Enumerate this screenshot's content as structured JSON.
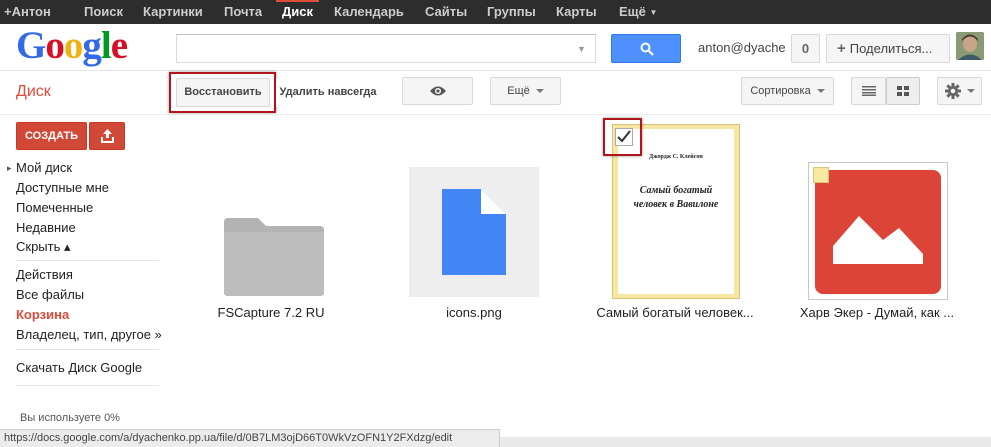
{
  "gbar": {
    "items": [
      {
        "label": "+Антон"
      },
      {
        "label": "Поиск"
      },
      {
        "label": "Картинки"
      },
      {
        "label": "Почта"
      },
      {
        "label": "Диск",
        "active": true
      },
      {
        "label": "Календарь"
      },
      {
        "label": "Сайты"
      },
      {
        "label": "Группы"
      },
      {
        "label": "Карты"
      },
      {
        "label": "Ещё"
      }
    ]
  },
  "header": {
    "logo": [
      "G",
      "o",
      "o",
      "g",
      "l",
      "e"
    ],
    "search_value": "",
    "user_email": "anton@dyachenko.pp.ua",
    "notification_count": "0",
    "share_label": "Поделиться..."
  },
  "toolbar": {
    "title": "Диск",
    "restore_label": "Восстановить",
    "delete_forever_label": "Удалить навсегда",
    "more_label": "Ещё",
    "sort_label": "Сортировка"
  },
  "sidebar": {
    "create_label": "СОЗДАТЬ",
    "items": [
      {
        "label": "Мой диск"
      },
      {
        "label": "Доступные мне"
      },
      {
        "label": "Помеченные"
      },
      {
        "label": "Недавние"
      },
      {
        "label": "Скрыть ▴"
      },
      {
        "label": "Действия"
      },
      {
        "label": "Все файлы"
      },
      {
        "label": "Корзина",
        "active": true
      },
      {
        "label": "Владелец, тип, другое »"
      },
      {
        "label": "Скачать Диск Google"
      }
    ],
    "usage_text": "Вы используете 0%"
  },
  "files": [
    {
      "name": "FSCapture 7.2 RU",
      "icon": "folder-icon"
    },
    {
      "name": "icons.png",
      "icon": "document-icon"
    },
    {
      "name": "Самый богатый человек...",
      "author": "Джордж С. Клейсон",
      "title_line1": "Самый богатый",
      "title_line2": "человек в Вавилоне",
      "selected": true
    },
    {
      "name": "Харв Экер - Думай, как ...",
      "icon": "image-icon"
    }
  ],
  "status_url": "https://docs.google.com/a/dyachenko.pp.ua/file/d/0B7LM3ojD66T0WkVzOFN1Y2FXdzg/edit",
  "colors": {
    "accent_red": "#dd4b39",
    "search_blue": "#4d90fe",
    "highlight": "#b0141c"
  }
}
